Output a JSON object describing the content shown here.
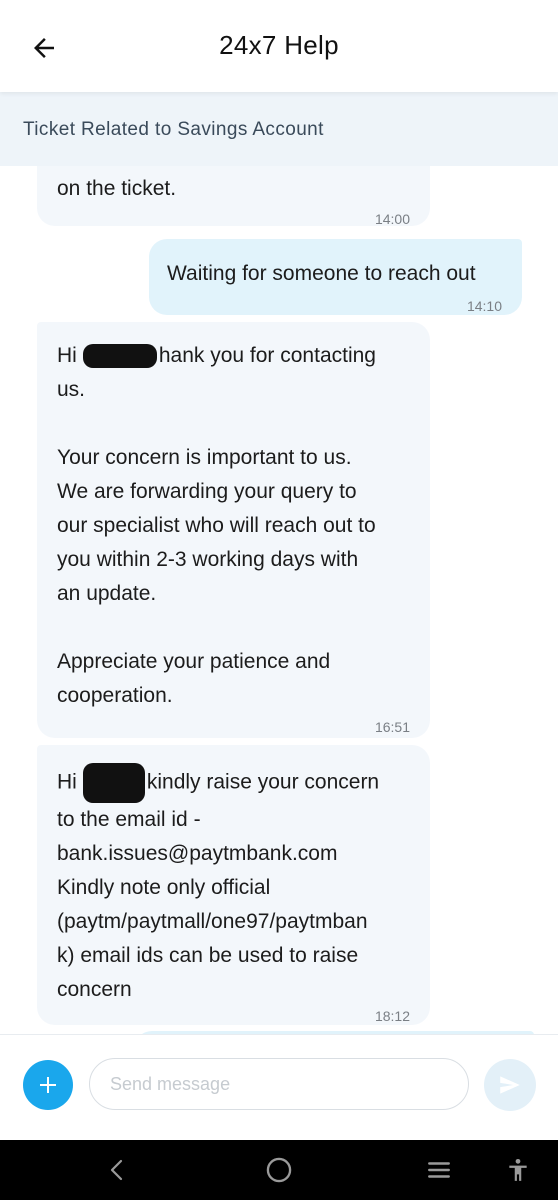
{
  "header": {
    "title": "24x7 Help",
    "back_icon": "arrow-left-icon"
  },
  "subheader": {
    "text": "Ticket Related to Savings Account"
  },
  "messages": [
    {
      "direction": "incoming",
      "lines": "on the ticket.",
      "time": "14:00"
    },
    {
      "direction": "outgoing",
      "lines": "Waiting for someone to reach out",
      "time": "14:10"
    },
    {
      "direction": "incoming",
      "greeting": "Hi",
      "greeting_rest": "hank you for contacting",
      "lines": "us.\n\nYour concern is important to us.\nWe are forwarding your query to\nour specialist who will reach out to\nyou within 2-3 working days with\nan update.\n\nAppreciate your patience and\ncooperation.",
      "time": "16:51"
    },
    {
      "direction": "incoming",
      "greeting": "Hi",
      "greeting_rest": "kindly raise your concern",
      "lines": "to the email id -\nbank.issues@paytmbank.com\nKindly note only official\n(paytm/paytmall/one97/paytmban\nk) email ids can be used to raise\nconcern",
      "time": "18:12"
    }
  ],
  "composer": {
    "placeholder": "Send message",
    "add_icon": "plus-icon",
    "send_icon": "send-icon",
    "accent_color": "#1aa7ec"
  },
  "system_nav": {
    "icons": [
      "back-chevron-icon",
      "home-circle-icon",
      "menu-lines-icon",
      "accessibility-icon"
    ]
  }
}
